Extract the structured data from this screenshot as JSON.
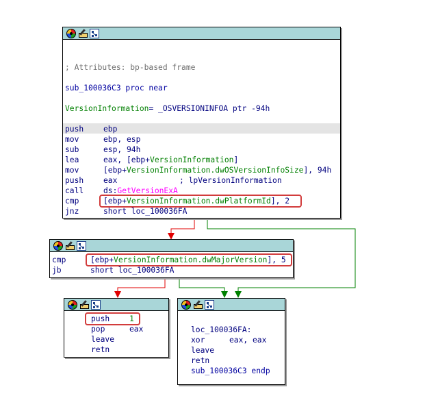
{
  "colors": {
    "titlebar": "#a9d6d8",
    "edge_true": "#008000",
    "edge_false": "#e00000",
    "highlight_box": "#d23c3c",
    "mnemonic": "#00007f",
    "struct_member": "#007f00",
    "import": "#ff00ff",
    "comment": "#6f6f6f"
  },
  "title_icons": [
    "color-icon",
    "edit-icon",
    "graph-icon"
  ],
  "node1": {
    "comment": "; Attributes: bp-based frame",
    "proc": "sub_100036C3 proc near",
    "var_name": "VersionInformation",
    "var_def": "= _OSVERSIONINFOA ptr -94h",
    "instr": [
      {
        "mn": "push",
        "op": "ebp"
      },
      {
        "mn": "mov",
        "op": "ebp, esp"
      },
      {
        "mn": "sub",
        "op": "esp, 94h"
      },
      {
        "mn": "lea",
        "op_a": "eax, [ebp+",
        "op_b": "VersionInformation",
        "op_c": "]"
      },
      {
        "mn": "mov",
        "op_a": "[ebp+",
        "op_b": "VersionInformation.dwOSVersionInfoSize",
        "op_c": "], 94h"
      },
      {
        "mn": "push",
        "op": "eax",
        "comment": "; lpVersionInformation"
      },
      {
        "mn": "call",
        "op_a": "ds:",
        "op_b": "GetVersionExA"
      },
      {
        "mn": "cmp",
        "op_a": "[ebp+",
        "op_b": "VersionInformation.dwPlatformId",
        "op_c": "], 2"
      },
      {
        "mn": "jnz",
        "op": "short loc_100036FA"
      }
    ]
  },
  "node2": {
    "instr": [
      {
        "mn": "cmp",
        "op_a": "[ebp+",
        "op_b": "VersionInformation.dwMajorVersion",
        "op_c": "], 5"
      },
      {
        "mn": "jb",
        "op": "short loc_100036FA"
      }
    ]
  },
  "node3": {
    "instr": [
      {
        "mn": "push",
        "op": "1"
      },
      {
        "mn": "pop",
        "op": "eax"
      },
      {
        "mn": "leave",
        "op": ""
      },
      {
        "mn": "retn",
        "op": ""
      }
    ]
  },
  "node4": {
    "label": "loc_100036FA:",
    "instr": [
      {
        "mn": "xor",
        "op": "eax, eax"
      },
      {
        "mn": "leave",
        "op": ""
      },
      {
        "mn": "retn",
        "op": ""
      }
    ],
    "endp": "sub_100036C3 endp"
  }
}
